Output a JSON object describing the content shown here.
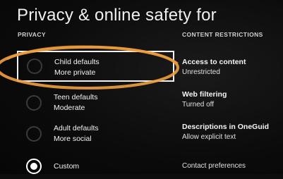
{
  "header": {
    "title": "Privacy & online safety for"
  },
  "sections": {
    "privacy": "PRIVACY",
    "content_restrictions": "CONTENT RESTRICTIONS"
  },
  "privacy_options": [
    {
      "line1": "Child defaults",
      "line2": "More private",
      "selected": false
    },
    {
      "line1": "Teen defaults",
      "line2": "Moderate",
      "selected": false
    },
    {
      "line1": "Adult defaults",
      "line2": "More social",
      "selected": false
    },
    {
      "line1": "Custom",
      "line2": "",
      "selected": true
    }
  ],
  "restrictions": [
    {
      "title": "Access to content",
      "value": "Unrestricted"
    },
    {
      "title": "Web filtering",
      "value": "Turned off"
    },
    {
      "title": "Descriptions in OneGuid",
      "value": "Allow explicit text"
    },
    {
      "title": "Contact preferences",
      "value": ""
    }
  ],
  "colors": {
    "annotation": "#f0a040",
    "focus_border": "#f2f2f2",
    "background": "#0d0d0d"
  }
}
